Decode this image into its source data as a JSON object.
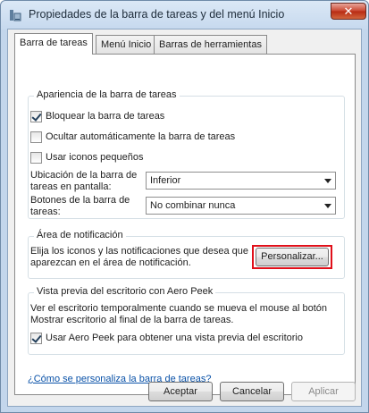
{
  "window": {
    "title": "Propiedades de la barra de tareas y del menú Inicio",
    "close_glyph": "✕"
  },
  "tabs": [
    {
      "label": "Barra de tareas",
      "active": true
    },
    {
      "label": "Menú Inicio",
      "active": false
    },
    {
      "label": "Barras de herramientas",
      "active": false
    }
  ],
  "appearance": {
    "legend": "Apariencia de la barra de tareas",
    "lock_taskbar": {
      "label": "Bloquear la barra de tareas",
      "checked": true
    },
    "autohide": {
      "label": "Ocultar automáticamente la barra de tareas",
      "checked": false
    },
    "small_icons": {
      "label": "Usar iconos pequeños",
      "checked": false
    },
    "location_label": "Ubicación de la barra de tareas en pantalla:",
    "location_value": "Inferior",
    "buttons_label": "Botones de la barra de tareas:",
    "buttons_value": "No combinar nunca"
  },
  "notification": {
    "legend": "Área de notificación",
    "description": "Elija los iconos y las notificaciones que desea que aparezcan en el área de notificación.",
    "customize_label": "Personalizar...",
    "highlight_color": "#e0101a"
  },
  "aero_peek": {
    "legend": "Vista previa del escritorio con Aero Peek",
    "description": "Ver el escritorio temporalmente cuando se mueva el mouse al botón Mostrar escritorio al final de la barra de tareas.",
    "use_peek": {
      "label": "Usar Aero Peek para obtener una vista previa del escritorio",
      "checked": true
    }
  },
  "help_link": "¿Cómo se personaliza la barra de tareas?",
  "footer": {
    "ok_label": "Aceptar",
    "cancel_label": "Cancelar",
    "apply_label": "Aplicar"
  }
}
